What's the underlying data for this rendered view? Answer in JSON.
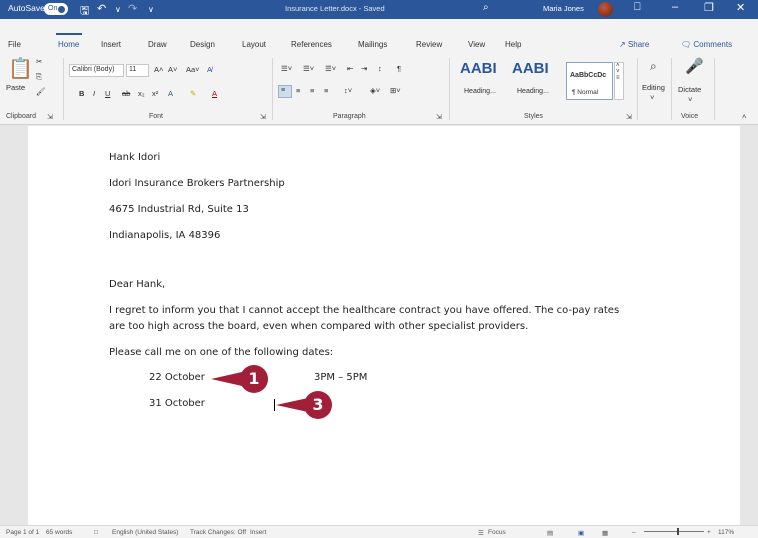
{
  "titlebar": {
    "autosave_label": "AutoSave",
    "autosave_state": "On",
    "doc_title": "Insurance Letter.docx - Saved",
    "user_name": "Maria Jones",
    "save_icon": "save-icon",
    "undo_icon": "undo-icon",
    "redo_icon": "redo-icon"
  },
  "tabs": [
    "File",
    "Home",
    "Insert",
    "Draw",
    "Design",
    "Layout",
    "References",
    "Mailings",
    "Review",
    "View",
    "Help"
  ],
  "share_label": "Share",
  "comments_label": "Comments",
  "ribbon": {
    "clipboard": {
      "paste": "Paste",
      "label": "Clipboard"
    },
    "font": {
      "name": "Calibri (Body)",
      "size": "11",
      "label": "Font"
    },
    "paragraph": {
      "label": "Paragraph"
    },
    "styles": {
      "tile1": "AABI",
      "tile1_sub": "Heading...",
      "tile2": "AABI",
      "tile2_sub": "Heading...",
      "tile3": "AaBbCcDc",
      "tile3_sub": "¶ Normal",
      "label": "Styles"
    },
    "editing": {
      "label": "Editing"
    },
    "voice": {
      "dictate": "Dictate",
      "label": "Voice"
    }
  },
  "document": {
    "address": [
      "Hank Idori",
      "Idori Insurance Brokers Partnership",
      "4675 Industrial Rd, Suite 13",
      "Indianapolis, IA 48396"
    ],
    "salutation": "Dear Hank,",
    "para1_line1": "I regret to inform you that I cannot accept the healthcare contract you have offered. The co-pay rates",
    "para1_line2": "are too high across the board, even when compared with other specialist providers.",
    "para2": "Please call me on one of the following dates:",
    "date1": "22 October",
    "time1": "3PM – 5PM",
    "date2": "31 October"
  },
  "callouts": {
    "step1": "1",
    "step3": "3",
    "color": "#a21f3a"
  },
  "status": {
    "page": "Page 1 of 1",
    "words": "65 words",
    "language": "English (United States)",
    "track_changes": "Track Changes: Off",
    "insert_mode": "Insert",
    "focus": "Focus",
    "zoom": "117%"
  },
  "colors": {
    "accent": "#2b579a"
  }
}
